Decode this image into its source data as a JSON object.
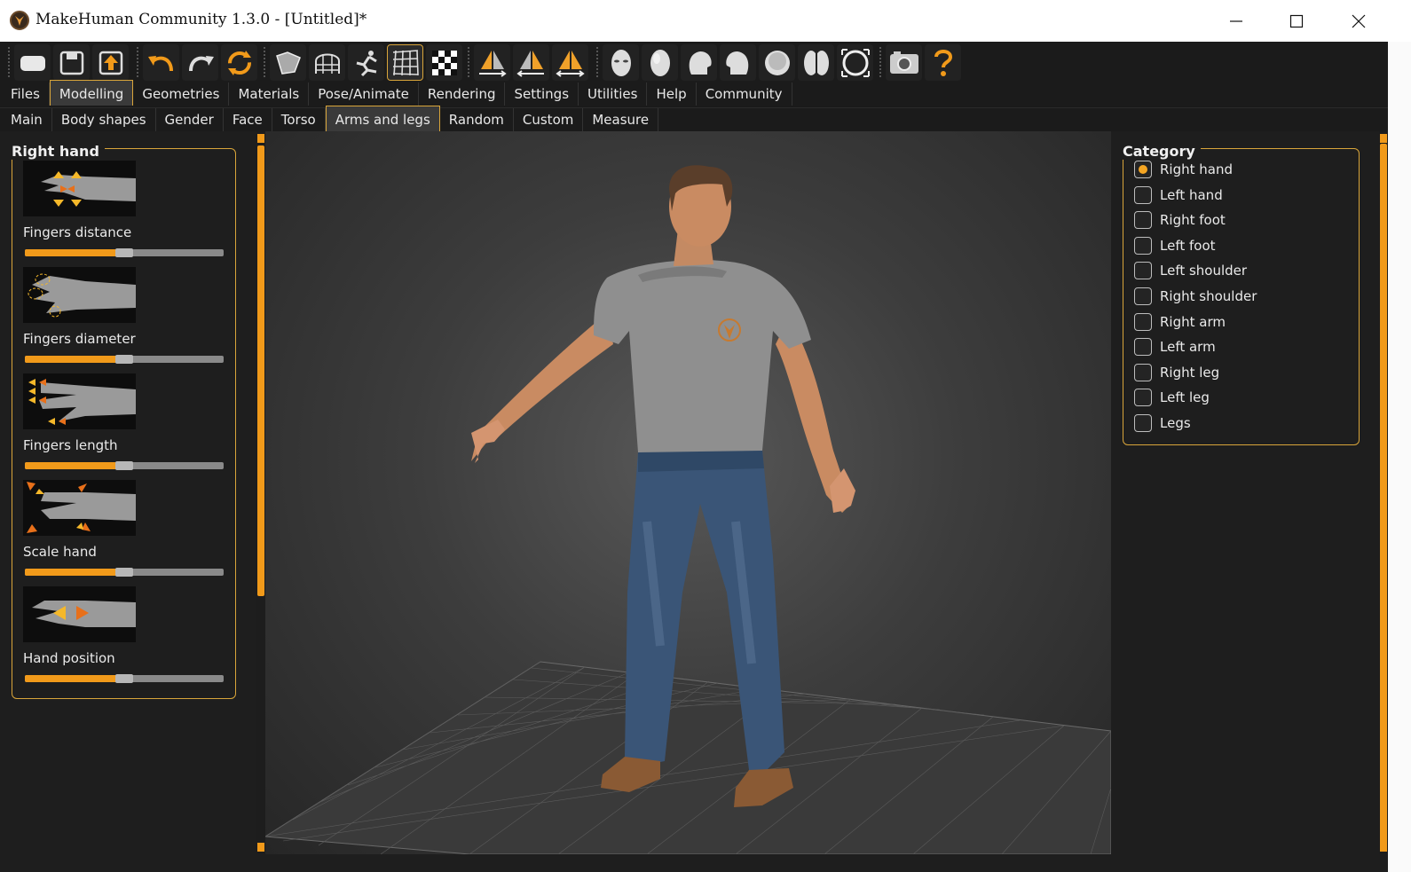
{
  "window": {
    "title": "MakeHuman Community 1.3.0 - [Untitled]*",
    "controls": [
      "minimize-icon",
      "maximize-icon",
      "close-icon"
    ]
  },
  "toolbar": {
    "groups": [
      [
        "new-icon",
        "save-icon",
        "export-icon"
      ],
      [
        "undo-icon",
        "redo-icon",
        "reset-icon"
      ],
      [
        "smooth-icon",
        "wireframe-icon",
        "skeleton-icon",
        "grid-icon",
        "checker-icon"
      ],
      [
        "front-view-icon",
        "back-view-icon",
        "side-view-icon"
      ],
      [
        "face-icon",
        "head-icon",
        "head-side-icon",
        "head-left-icon",
        "top-view-icon",
        "body-icon",
        "global-view-icon"
      ],
      [
        "screenshot-icon",
        "help-icon"
      ]
    ],
    "active": "grid-icon"
  },
  "tabs_main": [
    "Files",
    "Modelling",
    "Geometries",
    "Materials",
    "Pose/Animate",
    "Rendering",
    "Settings",
    "Utilities",
    "Help",
    "Community"
  ],
  "tabs_main_active": "Modelling",
  "tabs_sub": [
    "Main",
    "Body shapes",
    "Gender",
    "Face",
    "Torso",
    "Arms and legs",
    "Random",
    "Custom",
    "Measure"
  ],
  "tabs_sub_active": "Arms and legs",
  "left_panel": {
    "title": "Right hand",
    "sliders": [
      {
        "label": "Fingers distance",
        "value": 0.5,
        "icon": "fingers-distance-icon"
      },
      {
        "label": "Fingers diameter",
        "value": 0.5,
        "icon": "fingers-diameter-icon"
      },
      {
        "label": "Fingers length",
        "value": 0.5,
        "icon": "fingers-length-icon"
      },
      {
        "label": "Scale hand",
        "value": 0.5,
        "icon": "scale-hand-icon"
      },
      {
        "label": "Hand position",
        "value": 0.5,
        "icon": "hand-position-icon"
      }
    ]
  },
  "right_panel": {
    "title": "Category",
    "options": [
      "Right hand",
      "Left hand",
      "Right foot",
      "Left foot",
      "Left shoulder",
      "Right shoulder",
      "Right arm",
      "Left arm",
      "Right leg",
      "Left leg",
      "Legs"
    ],
    "selected": "Right hand"
  },
  "colors": {
    "accent": "#f19a1a",
    "panel_bg": "#1e1e1e",
    "border": "#d9a53a"
  }
}
